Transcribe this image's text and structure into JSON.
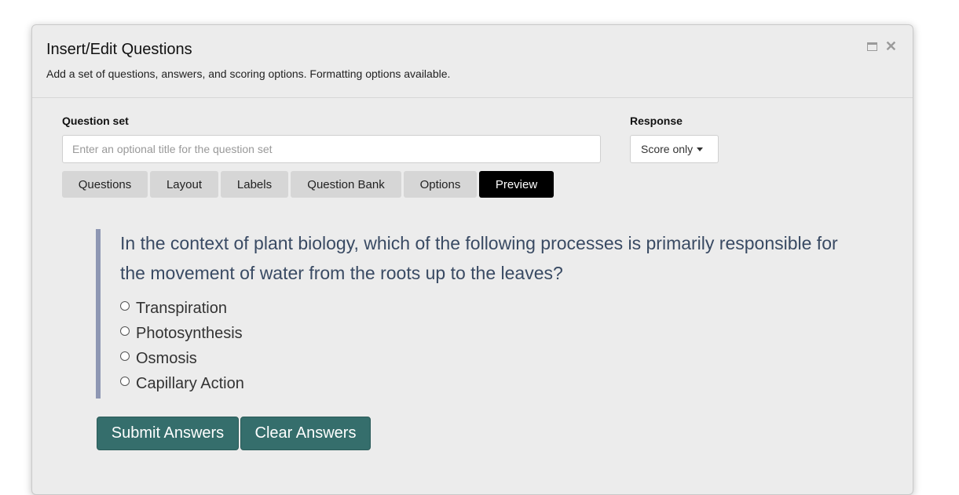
{
  "dialog": {
    "title": "Insert/Edit Questions",
    "subtitle": "Add a set of questions, answers, and scoring options. Formatting options available."
  },
  "question_set": {
    "label": "Question set",
    "value": "",
    "placeholder": "Enter an optional title for the question set"
  },
  "response": {
    "label": "Response",
    "selected": "Score only"
  },
  "tabs": [
    {
      "label": "Questions",
      "active": false
    },
    {
      "label": "Layout",
      "active": false
    },
    {
      "label": "Labels",
      "active": false
    },
    {
      "label": "Question Bank",
      "active": false
    },
    {
      "label": "Options",
      "active": false
    },
    {
      "label": "Preview",
      "active": true
    }
  ],
  "preview": {
    "question": "In the context of plant biology, which of the following processes is primarily responsible for the movement of water from the roots up to the leaves?",
    "options": [
      "Transpiration",
      "Photosynthesis",
      "Osmosis",
      "Capillary Action"
    ]
  },
  "actions": {
    "submit_label": "Submit Answers",
    "clear_label": "Clear Answers"
  },
  "colors": {
    "active_tab": "#000000",
    "action_button": "#356e6c",
    "question_border": "#8e97b3",
    "question_text": "#394a63"
  },
  "icons": [
    "maximize-icon",
    "close-icon",
    "chevron-down-icon",
    "radio-icon"
  ]
}
